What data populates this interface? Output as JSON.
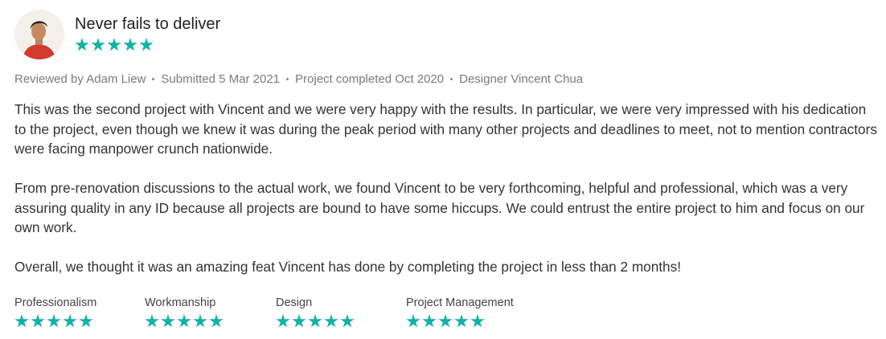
{
  "review": {
    "title": "Never fails to deliver",
    "overall_rating": 5,
    "meta": {
      "reviewer": "Reviewed by Adam Liew",
      "submitted": "Submitted 5 Mar 2021",
      "completed": "Project completed Oct 2020",
      "designer": "Designer Vincent Chua"
    },
    "paragraphs": [
      "This was the second project with Vincent and we were very happy with the results. In particular, we were very impressed with his dedication to the project, even though we knew it was during the peak period with many other projects and deadlines to meet, not to mention contractors were facing manpower crunch nationwide.",
      "From pre-renovation discussions to the actual work, we found Vincent to be very forthcoming, helpful and professional, which was a very assuring quality in any ID because all projects are bound to have some hiccups. We could entrust the entire project to him and focus on our own work.",
      "Overall, we thought it was an amazing feat Vincent has done by completing the project in less than 2 months!"
    ],
    "ratings": [
      {
        "label": "Professionalism",
        "stars": 5
      },
      {
        "label": "Workmanship",
        "stars": 5
      },
      {
        "label": "Design",
        "stars": 5
      },
      {
        "label": "Project Management",
        "stars": 5
      }
    ]
  },
  "colors": {
    "star": "#16b1a3",
    "meta_text": "#7a7a7a",
    "body_text": "#333333"
  },
  "icons": {
    "avatar": "reviewer-photo",
    "star": "star-icon",
    "separator": "dot-separator"
  }
}
